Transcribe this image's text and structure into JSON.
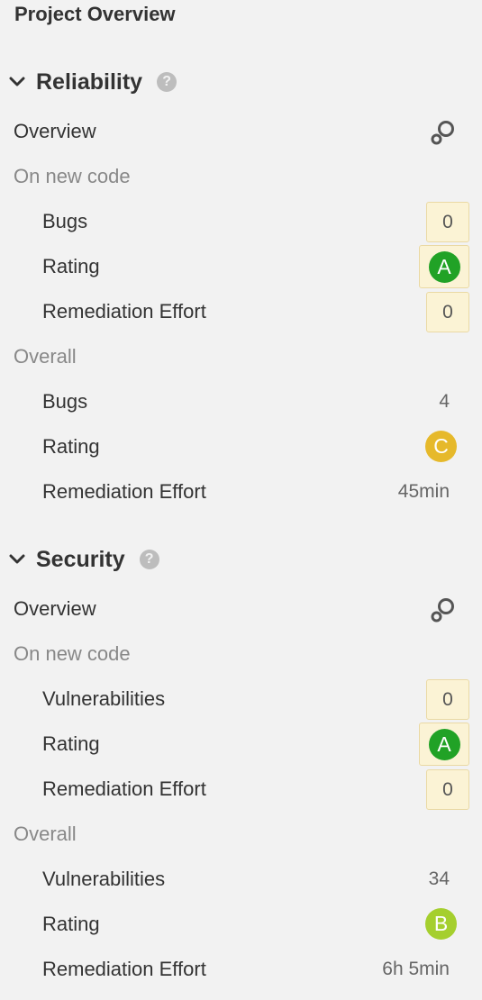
{
  "page": {
    "title": "Project Overview"
  },
  "colors": {
    "rating_a": "#21a226",
    "rating_b": "#a5cf2e",
    "rating_c": "#e6b92b",
    "new_code_highlight": "#fbf3d5"
  },
  "reliability": {
    "title": "Reliability",
    "help": "?",
    "overview_label": "Overview",
    "new_code": {
      "label": "On new code",
      "bugs_label": "Bugs",
      "bugs_value": "0",
      "rating_label": "Rating",
      "rating_value": "A",
      "effort_label": "Remediation Effort",
      "effort_value": "0"
    },
    "overall": {
      "label": "Overall",
      "bugs_label": "Bugs",
      "bugs_value": "4",
      "rating_label": "Rating",
      "rating_value": "C",
      "effort_label": "Remediation Effort",
      "effort_value": "45min"
    }
  },
  "security": {
    "title": "Security",
    "help": "?",
    "overview_label": "Overview",
    "new_code": {
      "label": "On new code",
      "vuln_label": "Vulnerabilities",
      "vuln_value": "0",
      "rating_label": "Rating",
      "rating_value": "A",
      "effort_label": "Remediation Effort",
      "effort_value": "0"
    },
    "overall": {
      "label": "Overall",
      "vuln_label": "Vulnerabilities",
      "vuln_value": "34",
      "rating_label": "Rating",
      "rating_value": "B",
      "effort_label": "Remediation Effort",
      "effort_value": "6h 5min"
    }
  },
  "icons": {
    "section_toggle": "chevron-down-icon",
    "help": "help-icon",
    "overview": "search-icon"
  }
}
